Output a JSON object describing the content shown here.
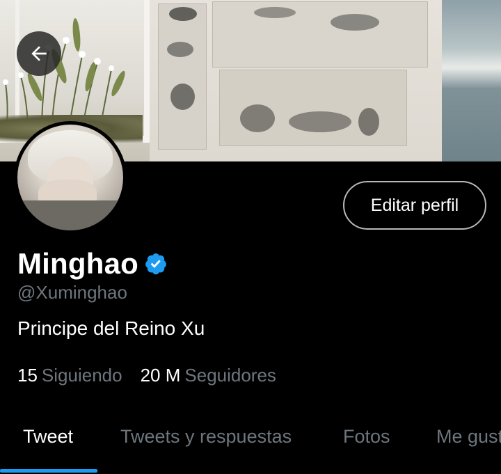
{
  "profile": {
    "display_name": "Minghao",
    "handle": "@Xuminghao",
    "bio": "Principe del Reino Xu",
    "verified": true
  },
  "actions": {
    "edit_profile_label": "Editar perfil",
    "back_icon": "arrow-left-icon"
  },
  "stats": [
    {
      "value": "15",
      "label": "Siguiendo"
    },
    {
      "value": "20 M",
      "label": "Seguidores"
    }
  ],
  "tabs": [
    {
      "label": "Tweet",
      "active": true
    },
    {
      "label": "Tweets y respuestas",
      "active": false
    },
    {
      "label": "Fotos",
      "active": false
    },
    {
      "label": "Me gustan",
      "active": false
    }
  ],
  "colors": {
    "background": "#000000",
    "accent": "#1d9bf0",
    "secondary_text": "#6e767d",
    "verified_badge": "#1d9bf0"
  }
}
